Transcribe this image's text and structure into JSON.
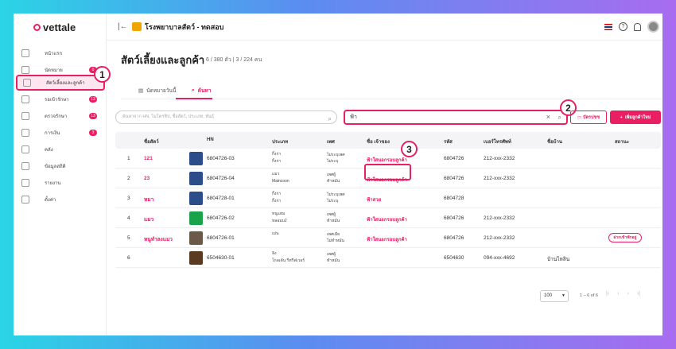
{
  "app": {
    "logo": "vettale",
    "hospital": "โรงพยาบาลสัตว์ - ทดสอบ"
  },
  "sidebar": {
    "items": [
      {
        "label": "หน้าแรก",
        "icon": "home-icon",
        "badge": ""
      },
      {
        "label": "นัดหมาย",
        "icon": "calendar-icon",
        "badge": "0"
      },
      {
        "label": "สัตว์เลี้ยงและลูกค้า",
        "icon": "paw-icon",
        "badge": ""
      },
      {
        "label": "รอเข้ารักษา",
        "icon": "queue-icon",
        "badge": "13"
      },
      {
        "label": "ตรวจรักษา",
        "icon": "stethoscope-icon",
        "badge": "13"
      },
      {
        "label": "การเงิน",
        "icon": "money-icon",
        "badge": "3"
      },
      {
        "label": "คลัง",
        "icon": "warehouse-icon",
        "badge": ""
      },
      {
        "label": "ข้อมูลสถิติ",
        "icon": "stats-icon",
        "badge": ""
      },
      {
        "label": "รายงาน",
        "icon": "report-icon",
        "badge": ""
      },
      {
        "label": "ตั้งค่า",
        "icon": "gear-icon",
        "badge": ""
      }
    ]
  },
  "callouts": [
    "1",
    "2",
    "3"
  ],
  "page": {
    "title": "สัตว์เลี้ยงและลูกค้า",
    "meta": "6 / 380 ตัว | 3 / 224 คน",
    "tabs": [
      {
        "label": "นัดหมายวันนี้",
        "icon": "clipboard-icon"
      },
      {
        "label": "ค้นหา",
        "icon": "search-icon"
      }
    ],
    "search_placeholder": "ค้นหาจาก HN, ไมโครชิป, ชื่อสัตว์, ประเภท, พันธุ์",
    "owner_search_value": "ฟ้า",
    "scan_button": "บัตรปชช",
    "add_button": "เพิ่มลูกค้าใหม่"
  },
  "table": {
    "headers": [
      "",
      "ชื่อสัตว์",
      "",
      "HN",
      "ประเภท",
      "เพศ",
      "ชื่อ เจ้าของ",
      "รหัส",
      "เบอร์โทรศัพท์",
      "ชื่อบ้าน",
      "สถานะ"
    ],
    "rows": [
      {
        "no": "1",
        "name": "121",
        "hn": "6804726-03",
        "type": "กิ้งก่า",
        "type2": "กิ้งก่า",
        "sex": "ไม่ระบุเพศ",
        "sex2": "ไม่ระบุ",
        "owner": "ฟ้าใสนอกรอบลูกค้า",
        "code": "6804726",
        "phone": "212-xxx-2332",
        "house": "",
        "status": ""
      },
      {
        "no": "2",
        "name": "23",
        "hn": "6804726-04",
        "type": "แมว",
        "type2": "Maincoon",
        "sex": "เพศผู้",
        "sex2": "ทำหมัน",
        "owner": "ฟ้าใสนอกรอบลูกค้า",
        "code": "6804726",
        "phone": "212-xxx-2332",
        "house": "",
        "status": ""
      },
      {
        "no": "3",
        "name": "หมา",
        "hn": "6804728-01",
        "type": "กิ้งก่า",
        "type2": "กิ้งก่า",
        "sex": "ไม่ระบุเพศ",
        "sex2": "ไม่ระบุ",
        "owner": "ฟ้าสวย",
        "code": "6804728",
        "phone": "",
        "house": "",
        "status": ""
      },
      {
        "no": "4",
        "name": "แมว",
        "hn": "6804726-02",
        "type": "หนูแฮม",
        "type2": "หลอมบ2",
        "sex": "เพศผู้",
        "sex2": "ทำหมัน",
        "owner": "ฟ้าใสนอกรอบลูกค้า",
        "code": "6804726",
        "phone": "212-xxx-2332",
        "house": "",
        "status": ""
      },
      {
        "no": "5",
        "name": "หนูทำลงแมว",
        "hn": "6804726-01",
        "type": "เม่น",
        "type2": "",
        "sex": "เพศเมีย",
        "sex2": "ไม่ทำหมัน",
        "owner": "ฟ้าใสนอกรอบลูกค้า",
        "code": "6804726",
        "phone": "212-xxx-2332",
        "house": "",
        "status": "ฝากเข้าพักอยู่"
      },
      {
        "no": "6",
        "name": "",
        "hn": "6504630-01",
        "type": "ลิง",
        "type2": "โกลเด้น รีทรีฟเวอร์",
        "sex": "เพศผู้",
        "sex2": "ทำหมัน",
        "owner": "",
        "code": "6504630",
        "phone": "094-xxx-4692",
        "house": "บ้านไหลิน",
        "status": ""
      }
    ]
  },
  "pagination": {
    "page_size": "100",
    "info": "1 – 6 of 6"
  },
  "colors": {
    "accent": "#e91e63",
    "header_bg": "#f4f4f7"
  }
}
